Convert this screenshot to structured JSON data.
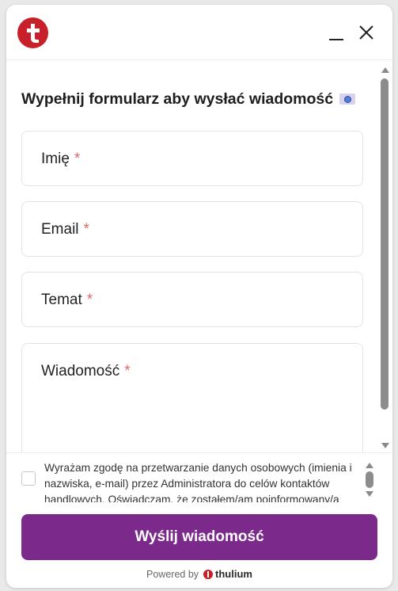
{
  "header": {
    "logo_icon": "thulium-logo-icon",
    "minimize_icon": "minimize-icon",
    "close_icon": "close-icon"
  },
  "form": {
    "title": "Wypełnij formularz aby wysłać wiadomość",
    "title_emoji_icon": "envelope-emoji-icon",
    "required_marker": "*",
    "fields": [
      {
        "label": "Imię"
      },
      {
        "label": "Email"
      },
      {
        "label": "Temat"
      },
      {
        "label": "Wiadomość"
      }
    ]
  },
  "consent": {
    "text": "Wyrażam zgodę na przetwarzanie danych osobowych (imienia i nazwiska, e-mail) przez Administratora do celów kontaktów handlowych. Oświadczam, że zostałem/am poinformowany/a"
  },
  "submit": {
    "label": "Wyślij wiadomość"
  },
  "footer": {
    "powered_by": "Powered by",
    "brand": "thulium"
  },
  "colors": {
    "brand_red": "#c8202a",
    "accent_purple": "#7b2a8c",
    "required_red": "#e06a6a"
  }
}
